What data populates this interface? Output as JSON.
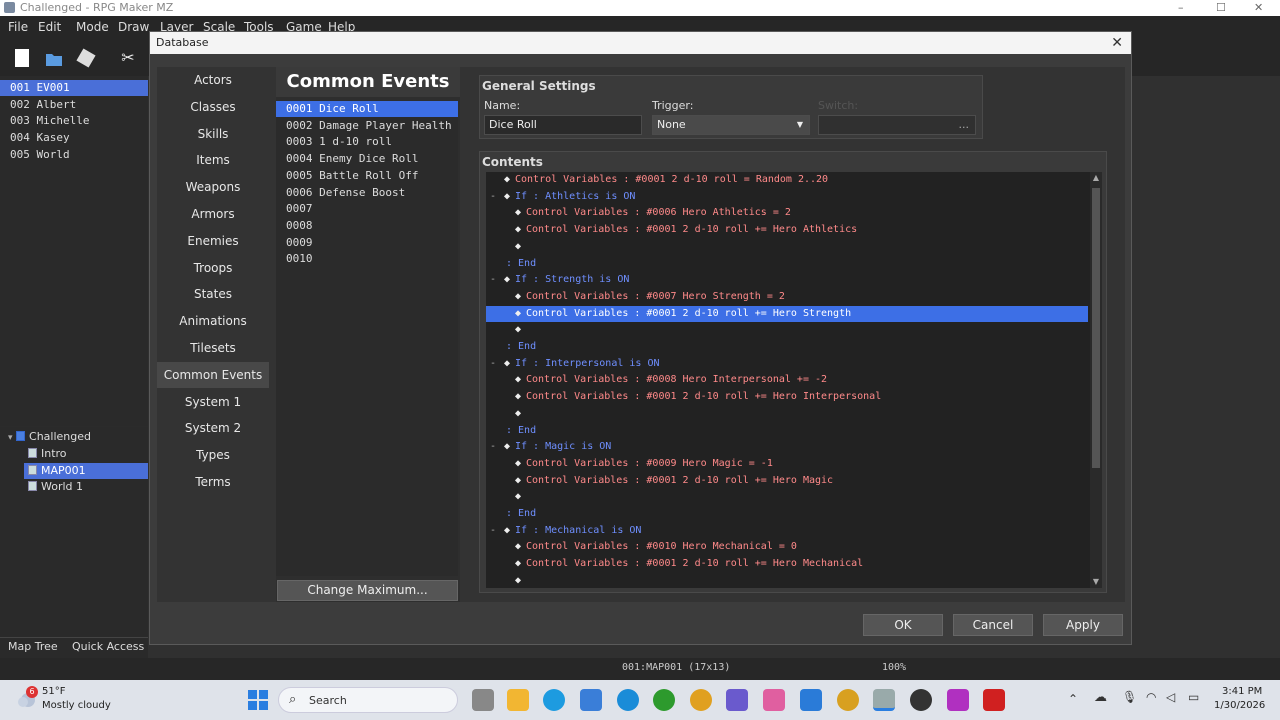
{
  "window": {
    "title": "Challenged - RPG Maker MZ",
    "min": "–",
    "max": "☐",
    "close": "✕"
  },
  "menubar": [
    "File",
    "Edit",
    "Mode",
    "Draw",
    "Layer",
    "Scale",
    "Tools",
    "Game",
    "Help"
  ],
  "maplist": [
    {
      "label": "001 EV001",
      "selected": true
    },
    {
      "label": "002 Albert",
      "selected": false
    },
    {
      "label": "003 Michelle",
      "selected": false
    },
    {
      "label": "004 Kasey",
      "selected": false
    },
    {
      "label": "005 World",
      "selected": false
    }
  ],
  "maptree": {
    "root": "Challenged",
    "items": [
      {
        "label": "Intro",
        "selected": false
      },
      {
        "label": "MAP001",
        "selected": true
      },
      {
        "label": "World 1",
        "selected": false
      }
    ]
  },
  "bottom_tabs": [
    "Map Tree",
    "Quick Access"
  ],
  "statusbar": {
    "map": "001:MAP001 (17x13)",
    "zoom": "100%"
  },
  "dialog": {
    "title": "Database",
    "close": "✕",
    "categories": [
      "Actors",
      "Classes",
      "Skills",
      "Items",
      "Weapons",
      "Armors",
      "Enemies",
      "Troops",
      "States",
      "Animations",
      "Tilesets",
      "Common Events",
      "System 1",
      "System 2",
      "Types",
      "Terms"
    ],
    "selected_category": "Common Events",
    "common_events_header": "Common Events",
    "common_events": [
      {
        "label": "0001 Dice Roll",
        "selected": true
      },
      {
        "label": "0002 Damage Player Health",
        "selected": false
      },
      {
        "label": "0003 1 d-10 roll",
        "selected": false
      },
      {
        "label": "0004 Enemy Dice Roll",
        "selected": false
      },
      {
        "label": "0005 Battle Roll Off",
        "selected": false
      },
      {
        "label": "0006 Defense Boost",
        "selected": false
      },
      {
        "label": "0007",
        "selected": false
      },
      {
        "label": "0008",
        "selected": false
      },
      {
        "label": "0009",
        "selected": false
      },
      {
        "label": "0010",
        "selected": false
      }
    ],
    "change_max": "Change Maximum...",
    "general": {
      "title": "General Settings",
      "name_label": "Name:",
      "name_value": "Dice Roll",
      "trigger_label": "Trigger:",
      "trigger_value": "None",
      "switch_label": "Switch:",
      "switch_btn": "..."
    },
    "contents_title": "Contents",
    "commands": [
      {
        "indent": 0,
        "fold": "",
        "text": "Control Variables : #0001 2 d-10 roll = Random 2..20",
        "kind": "var",
        "selected": false
      },
      {
        "indent": 0,
        "fold": "-",
        "text": "If : Athletics is ON",
        "kind": "if",
        "selected": false
      },
      {
        "indent": 1,
        "fold": "",
        "text": "Control Variables : #0006 Hero Athletics = 2",
        "kind": "var",
        "selected": false
      },
      {
        "indent": 1,
        "fold": "",
        "text": "Control Variables : #0001 2 d-10 roll += Hero Athletics",
        "kind": "var",
        "selected": false
      },
      {
        "indent": 1,
        "fold": "",
        "text": "",
        "kind": "empty",
        "selected": false
      },
      {
        "indent": 0,
        "fold": "",
        "text": ": End",
        "kind": "end",
        "selected": false
      },
      {
        "indent": 0,
        "fold": "-",
        "text": "If : Strength is ON",
        "kind": "if",
        "selected": false
      },
      {
        "indent": 1,
        "fold": "",
        "text": "Control Variables : #0007 Hero Strength = 2",
        "kind": "var",
        "selected": false
      },
      {
        "indent": 1,
        "fold": "",
        "text": "Control Variables : #0001 2 d-10 roll += Hero Strength",
        "kind": "var",
        "selected": true
      },
      {
        "indent": 1,
        "fold": "",
        "text": "",
        "kind": "empty",
        "selected": false
      },
      {
        "indent": 0,
        "fold": "",
        "text": ": End",
        "kind": "end",
        "selected": false
      },
      {
        "indent": 0,
        "fold": "-",
        "text": "If : Interpersonal is ON",
        "kind": "if",
        "selected": false
      },
      {
        "indent": 1,
        "fold": "",
        "text": "Control Variables : #0008 Hero Interpersonal += -2",
        "kind": "var",
        "selected": false
      },
      {
        "indent": 1,
        "fold": "",
        "text": "Control Variables : #0001 2 d-10 roll += Hero Interpersonal",
        "kind": "var",
        "selected": false
      },
      {
        "indent": 1,
        "fold": "",
        "text": "",
        "kind": "empty",
        "selected": false
      },
      {
        "indent": 0,
        "fold": "",
        "text": ": End",
        "kind": "end",
        "selected": false
      },
      {
        "indent": 0,
        "fold": "-",
        "text": "If : Magic is ON",
        "kind": "if",
        "selected": false
      },
      {
        "indent": 1,
        "fold": "",
        "text": "Control Variables : #0009 Hero Magic = -1",
        "kind": "var",
        "selected": false
      },
      {
        "indent": 1,
        "fold": "",
        "text": "Control Variables : #0001 2 d-10 roll += Hero Magic",
        "kind": "var",
        "selected": false
      },
      {
        "indent": 1,
        "fold": "",
        "text": "",
        "kind": "empty",
        "selected": false
      },
      {
        "indent": 0,
        "fold": "",
        "text": ": End",
        "kind": "end",
        "selected": false
      },
      {
        "indent": 0,
        "fold": "-",
        "text": "If : Mechanical is ON",
        "kind": "if",
        "selected": false
      },
      {
        "indent": 1,
        "fold": "",
        "text": "Control Variables : #0010 Hero Mechanical = 0",
        "kind": "var",
        "selected": false
      },
      {
        "indent": 1,
        "fold": "",
        "text": "Control Variables : #0001 2 d-10 roll += Hero Mechanical",
        "kind": "var",
        "selected": false
      },
      {
        "indent": 1,
        "fold": "",
        "text": "",
        "kind": "empty",
        "selected": false
      }
    ],
    "buttons": {
      "ok": "OK",
      "cancel": "Cancel",
      "apply": "Apply"
    }
  },
  "colors": {
    "var": "#ff8a8a",
    "if": "#6f8fff",
    "end": "#6f8fff",
    "selection": "#3d6fe6"
  },
  "taskbar": {
    "weather_temp": "51°F",
    "weather_desc": "Mostly cloudy",
    "weather_badge": "6",
    "search": "Search",
    "time": "3:41 PM",
    "date": "1/30/2026"
  }
}
